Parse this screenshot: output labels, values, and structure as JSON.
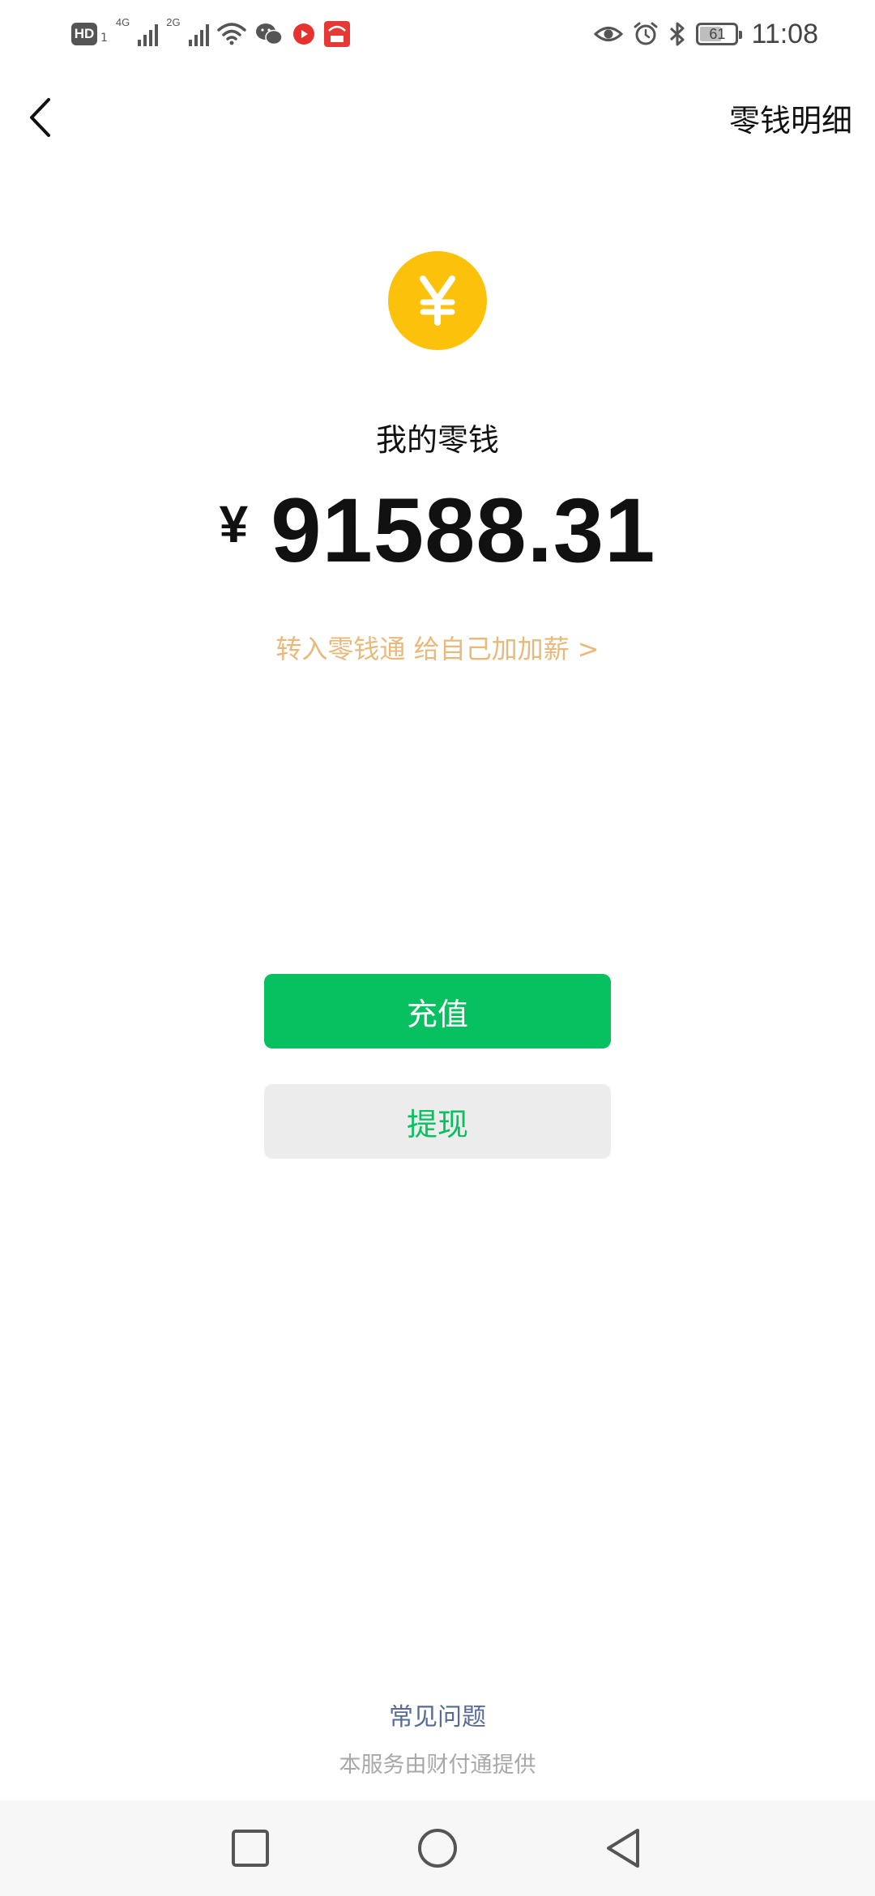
{
  "status_bar": {
    "hd_label": "HD",
    "hd_sub": "1",
    "network_1": "4G",
    "network_2": "2G",
    "battery": "61",
    "time": "11:08",
    "icons": [
      "hd-icon",
      "signal-icon",
      "wifi-icon",
      "wechat-icon",
      "record-icon",
      "app-icon",
      "eye-icon",
      "alarm-icon",
      "bluetooth-icon",
      "battery-icon"
    ]
  },
  "header": {
    "back_icon": "chevron-left-icon",
    "detail_link": "零钱明细"
  },
  "wallet": {
    "coin_symbol": "¥",
    "label": "我的零钱",
    "currency": "¥",
    "amount": "91588.31",
    "promo": "转入零钱通  给自己加加薪 >"
  },
  "actions": {
    "recharge": "充值",
    "withdraw": "提现"
  },
  "footer": {
    "faq": "常见问题",
    "provider": "本服务由财付通提供"
  },
  "system_nav": {
    "icons": [
      "recent-apps-icon",
      "home-icon",
      "back-triangle-icon"
    ]
  },
  "colors": {
    "accent_green": "#07c160",
    "coin_yellow": "#fcc10b",
    "promo_gold": "#e8b97a",
    "link_blue": "#576b95"
  }
}
